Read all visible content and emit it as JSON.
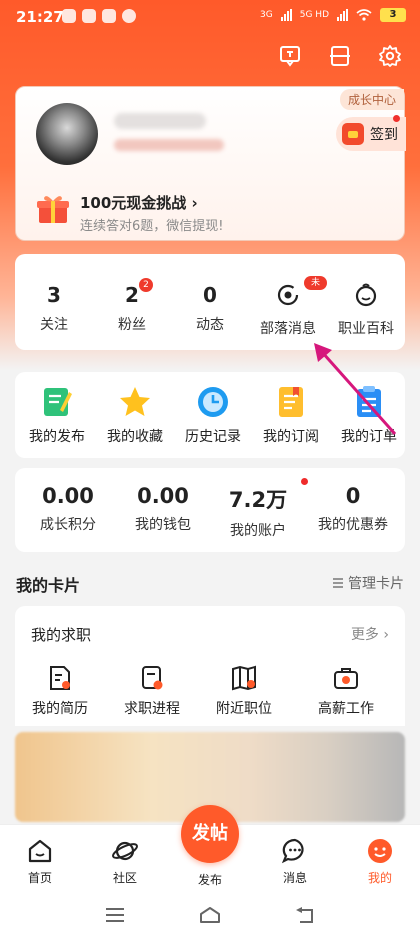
{
  "status_bar": {
    "time": "21:27",
    "battery": "3",
    "net1": "3G",
    "net2": "5G HD"
  },
  "profile": {
    "growth_center": "成长中心",
    "signin": "签到",
    "challenge_title": "100元现金挑战 ›",
    "challenge_sub": "连续答对6题，微信提现!"
  },
  "stats": [
    {
      "value": "3",
      "label": "关注"
    },
    {
      "value": "2",
      "label": "粉丝",
      "badge": "2"
    },
    {
      "value": "0",
      "label": "动态"
    },
    {
      "label": "部落消息",
      "icon": "ring-icon",
      "badge": "未读"
    },
    {
      "label": "职业百科",
      "icon": "face-icon"
    }
  ],
  "shortcuts": [
    {
      "label": "我的发布",
      "icon": "publish-icon"
    },
    {
      "label": "我的收藏",
      "icon": "star-icon"
    },
    {
      "label": "历史记录",
      "icon": "clock-icon"
    },
    {
      "label": "我的订阅",
      "icon": "subscribe-icon"
    },
    {
      "label": "我的订单",
      "icon": "order-icon"
    }
  ],
  "wallet": [
    {
      "value": "0.00",
      "label": "成长积分"
    },
    {
      "value": "0.00",
      "label": "我的钱包"
    },
    {
      "value": "7.2万",
      "label": "我的账户"
    },
    {
      "value": "0",
      "label": "我的优惠券"
    }
  ],
  "cards": {
    "title": "我的卡片",
    "manage": "管理卡片",
    "job_title": "我的求职",
    "job_more": "更多 ›",
    "job_items": [
      {
        "label": "我的简历"
      },
      {
        "label": "求职进程"
      },
      {
        "label": "附近职位"
      },
      {
        "label": "高薪工作"
      }
    ]
  },
  "nav": {
    "home": "首页",
    "community": "社区",
    "post_fab": "发帖",
    "post": "发布",
    "messages": "消息",
    "mine": "我的"
  },
  "colors": {
    "accent": "#ff5a2a",
    "badge": "#ef3a2c",
    "annotation": "#d6177c"
  }
}
